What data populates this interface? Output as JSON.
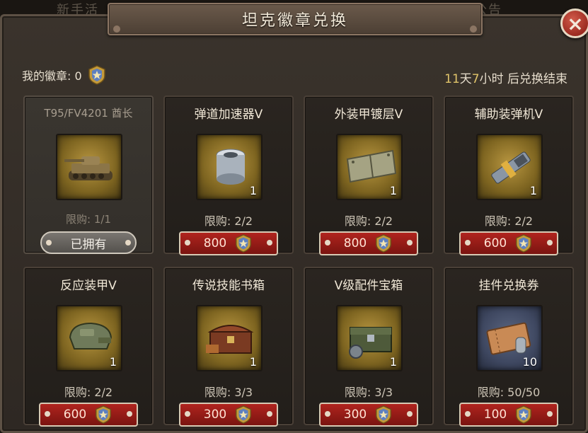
{
  "background": {
    "left_text": "新手活",
    "right_text": "公告"
  },
  "dialog": {
    "title": "坦克徽章兑换",
    "close_symbol": "×"
  },
  "badges": {
    "label": "我的徽章: 0"
  },
  "timer": {
    "days": "11",
    "days_unit": "天",
    "hours": "7",
    "hours_unit": "小时",
    "suffix": " 后兑换结束"
  },
  "colors": {
    "accent_gold": "#e0c46a",
    "price_red": "#b0241e",
    "close_red": "#9c2b21"
  },
  "items": [
    {
      "name": "T95/FV4201 酋长",
      "icon": "tank-icon",
      "qty": "",
      "limit": "限购: 1/1",
      "price": "",
      "owned_label": "已拥有",
      "owned": true
    },
    {
      "name": "弹道加速器V",
      "icon": "accelerator-icon",
      "qty": "1",
      "limit": "限购: 2/2",
      "price": "800",
      "owned": false
    },
    {
      "name": "外装甲镀层V",
      "icon": "armor-plate-icon",
      "qty": "1",
      "limit": "限购: 2/2",
      "price": "800",
      "owned": false
    },
    {
      "name": "辅助装弹机V",
      "icon": "loader-icon",
      "qty": "1",
      "limit": "限购: 2/2",
      "price": "600",
      "owned": false
    },
    {
      "name": "反应装甲V",
      "icon": "reactive-armor-icon",
      "qty": "1",
      "limit": "限购: 2/2",
      "price": "600",
      "owned": false
    },
    {
      "name": "传说技能书箱",
      "icon": "chest-icon",
      "qty": "1",
      "limit": "限购: 3/3",
      "price": "300",
      "owned": false
    },
    {
      "name": "V级配件宝箱",
      "icon": "parts-chest-icon",
      "qty": "1",
      "limit": "限购: 3/3",
      "price": "300",
      "owned": false
    },
    {
      "name": "挂件兑换券",
      "icon": "ticket-icon",
      "qty": "10",
      "limit": "限购: 50/50",
      "price": "100",
      "owned": false
    }
  ]
}
